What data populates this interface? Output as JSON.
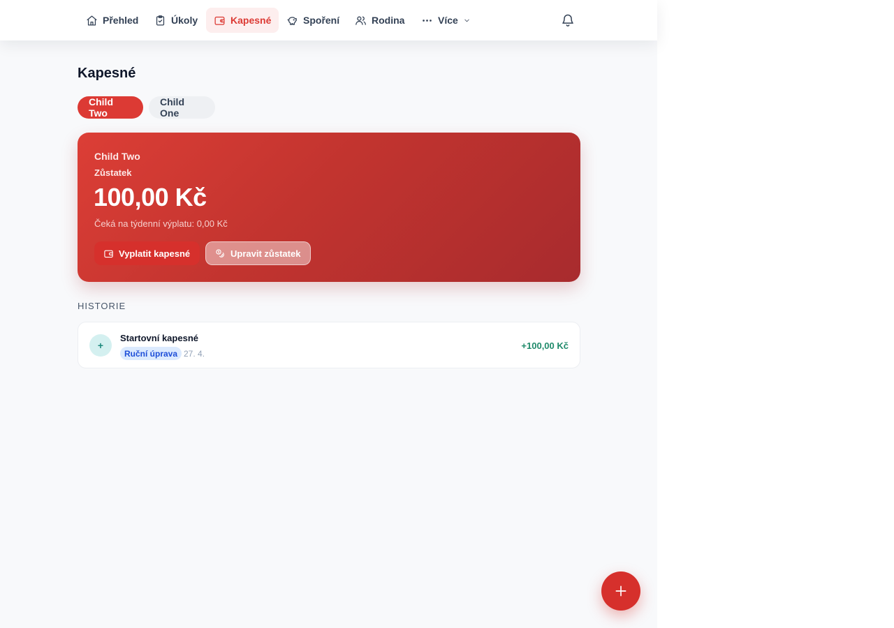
{
  "nav": {
    "items": [
      {
        "label": "Přehled",
        "icon": "home-icon"
      },
      {
        "label": "Úkoly",
        "icon": "clipboard-check-icon"
      },
      {
        "label": "Kapesné",
        "icon": "wallet-icon"
      },
      {
        "label": "Spoření",
        "icon": "piggy-bank-icon"
      },
      {
        "label": "Rodina",
        "icon": "users-icon"
      },
      {
        "label": "Více",
        "icon": "more-dots-icon"
      }
    ],
    "active": "Kapesné",
    "notifications_icon": "bell-icon"
  },
  "page": {
    "title": "Kapesné"
  },
  "children": {
    "tabs": [
      "Child Two",
      "Child One"
    ],
    "selected": "Child Two"
  },
  "balance_card": {
    "child_name": "Child Two",
    "label": "Zůstatek",
    "amount": "100,00 Kč",
    "pending": "Čeká na týdenní výplatu: 0,00 Kč",
    "pay_button": "Vyplatit kapesné",
    "edit_button": "Upravit zůstatek"
  },
  "history": {
    "title": "HISTORIE",
    "items": [
      {
        "icon_glyph": "+",
        "title": "Startovní kapesné",
        "badge": "Ruční úprava",
        "date": "27. 4.",
        "amount": "+100,00 Kč"
      }
    ]
  },
  "colors": {
    "accent": "#dc3a34",
    "positive": "#1f8a6a",
    "badge_blue": "#1d4ed8"
  }
}
